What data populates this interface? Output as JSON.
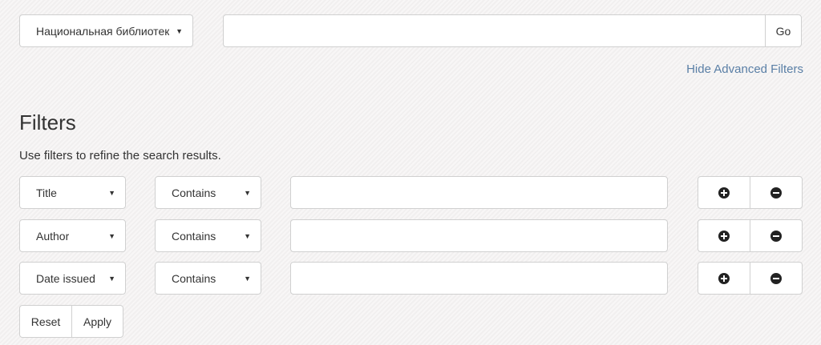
{
  "search": {
    "scope_select": "Национальная библиотек",
    "query_value": "",
    "go_label": "Go"
  },
  "advanced": {
    "toggle_label": "Hide Advanced Filters"
  },
  "filters": {
    "heading": "Filters",
    "description": "Use filters to refine the search results.",
    "rows": [
      {
        "field": "Title",
        "operator": "Contains",
        "value": ""
      },
      {
        "field": "Author",
        "operator": "Contains",
        "value": ""
      },
      {
        "field": "Date issued",
        "operator": "Contains",
        "value": ""
      }
    ],
    "reset_label": "Reset",
    "apply_label": "Apply"
  },
  "icons": {
    "add": "plus-circle-icon",
    "remove": "minus-circle-icon",
    "caret": "caret-down-icon"
  }
}
